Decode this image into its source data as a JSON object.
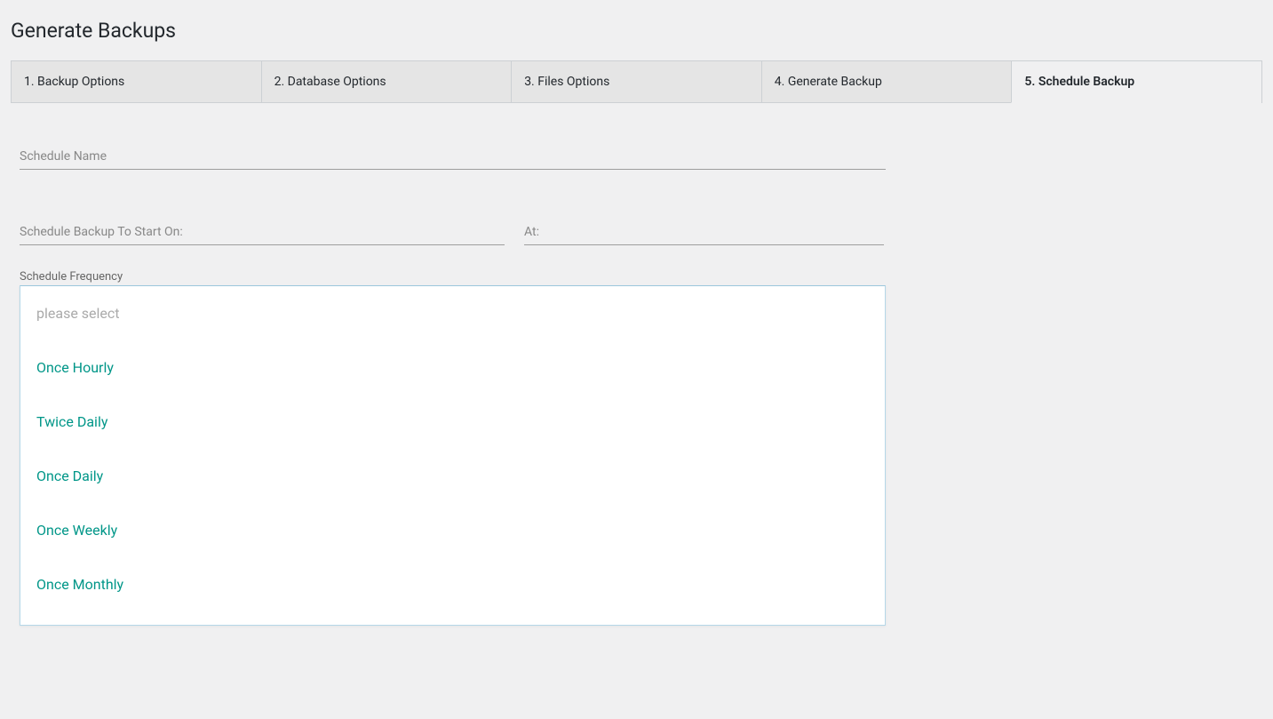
{
  "page": {
    "title": "Generate Backups"
  },
  "tabs": [
    {
      "label": "1. Backup Options",
      "active": false
    },
    {
      "label": "2. Database Options",
      "active": false
    },
    {
      "label": "3. Files Options",
      "active": false
    },
    {
      "label": "4. Generate Backup",
      "active": false
    },
    {
      "label": "5. Schedule Backup",
      "active": true
    }
  ],
  "fields": {
    "schedule_name": {
      "placeholder": "Schedule Name",
      "value": ""
    },
    "start_on": {
      "placeholder": "Schedule Backup To Start On:",
      "value": ""
    },
    "at": {
      "placeholder": "At:",
      "value": ""
    },
    "frequency_label": "Schedule Frequency"
  },
  "frequency_dropdown": {
    "placeholder": "please select",
    "options": [
      "Once Hourly",
      "Twice Daily",
      "Once Daily",
      "Once Weekly",
      "Once Monthly"
    ]
  }
}
